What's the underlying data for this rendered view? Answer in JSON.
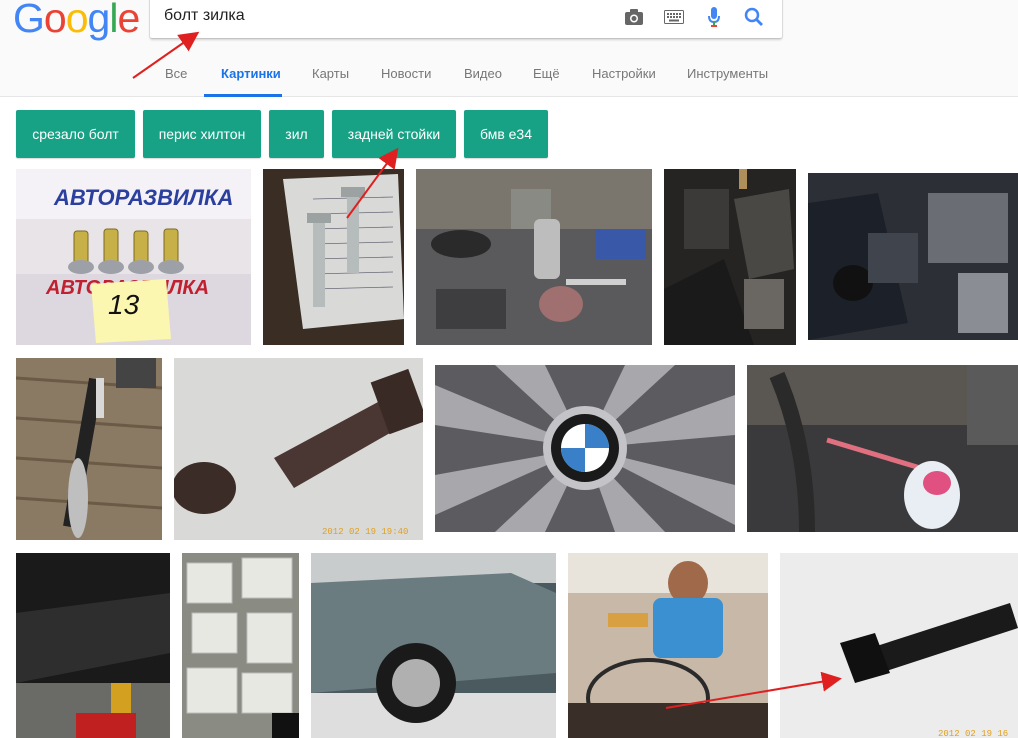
{
  "logo": [
    "G",
    "o",
    "o",
    "g",
    "l",
    "e"
  ],
  "search": {
    "value": "болт зилка"
  },
  "tabs": [
    {
      "label": "Все"
    },
    {
      "label": "Картинки"
    },
    {
      "label": "Карты"
    },
    {
      "label": "Новости"
    },
    {
      "label": "Видео"
    },
    {
      "label": "Ещё"
    },
    {
      "label": "Настройки"
    },
    {
      "label": "Инструменты"
    }
  ],
  "chips": [
    {
      "label": "срезало болт"
    },
    {
      "label": "перис хилтон"
    },
    {
      "label": "зил"
    },
    {
      "label": "задней стойки"
    },
    {
      "label": "бмв е34"
    }
  ],
  "images": {
    "auto_text_top": "АВТОРАЗВИЛКА",
    "auto_text_bottom": "АВТОРАЗВИЛКА",
    "auto_number": "13",
    "stamp_1": "2012 02 19  19:40",
    "stamp_2": "2012 02 19  16"
  },
  "colors": {
    "accent": "#1a73e8",
    "chip": "#17a185",
    "annotation_arrow": "#e02020"
  }
}
